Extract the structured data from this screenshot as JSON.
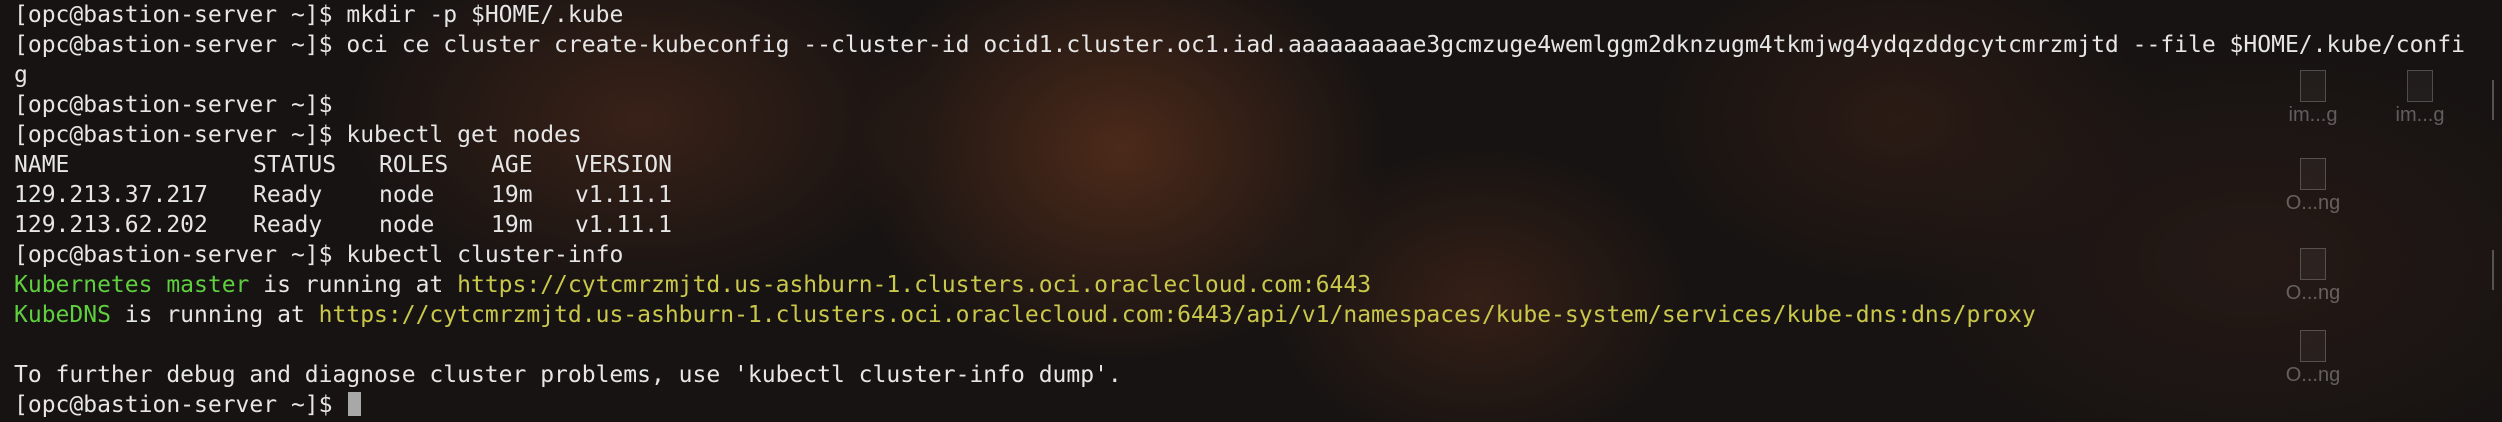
{
  "terminal": {
    "lines": [
      {
        "prompt": "[opc@bastion-server ~]$ ",
        "cmd": "mkdir -p $HOME/.kube"
      },
      {
        "prompt": "[opc@bastion-server ~]$ ",
        "cmd": "oci ce cluster create-kubeconfig --cluster-id ocid1.cluster.oc1.iad.aaaaaaaaae3gcmzuge4wemlggm2dknzugm4tkmjwg4ydqzddgcytcmrzmjtd --file $HOME/.kube/confi"
      },
      {
        "text": "g"
      },
      {
        "prompt": "[opc@bastion-server ~]$",
        "cmd": ""
      },
      {
        "prompt": "[opc@bastion-server ~]$ ",
        "cmd": "kubectl get nodes"
      }
    ],
    "nodes_table": {
      "headers": [
        "NAME",
        "STATUS",
        "ROLES",
        "AGE",
        "VERSION"
      ],
      "rows": [
        [
          "129.213.37.217",
          "Ready",
          "node",
          "19m",
          "v1.11.1"
        ],
        [
          "129.213.62.202",
          "Ready",
          "node",
          "19m",
          "v1.11.1"
        ]
      ]
    },
    "cluster_info_prompt": {
      "prompt": "[opc@bastion-server ~]$ ",
      "cmd": "kubectl cluster-info"
    },
    "master": {
      "label": "Kubernetes master",
      "mid": " is running at ",
      "url": "https://cytcmrzmjtd.us-ashburn-1.clusters.oci.oraclecloud.com:6443"
    },
    "dns": {
      "label": "KubeDNS",
      "mid": " is running at ",
      "url": "https://cytcmrzmjtd.us-ashburn-1.clusters.oci.oraclecloud.com:6443/api/v1/namespaces/kube-system/services/kube-dns:dns/proxy"
    },
    "debug_hint": "To further debug and diagnose cluster problems, use 'kubectl cluster-info dump'.",
    "last_prompt": "[opc@bastion-server ~]$ "
  },
  "desktop_icons": [
    "im...g",
    "im...g",
    "O...ng",
    "O...ng",
    "O...ng"
  ],
  "colors": {
    "green": "#5fcf3f",
    "yellow": "#c9c84a",
    "text": "#e6e6e6"
  }
}
